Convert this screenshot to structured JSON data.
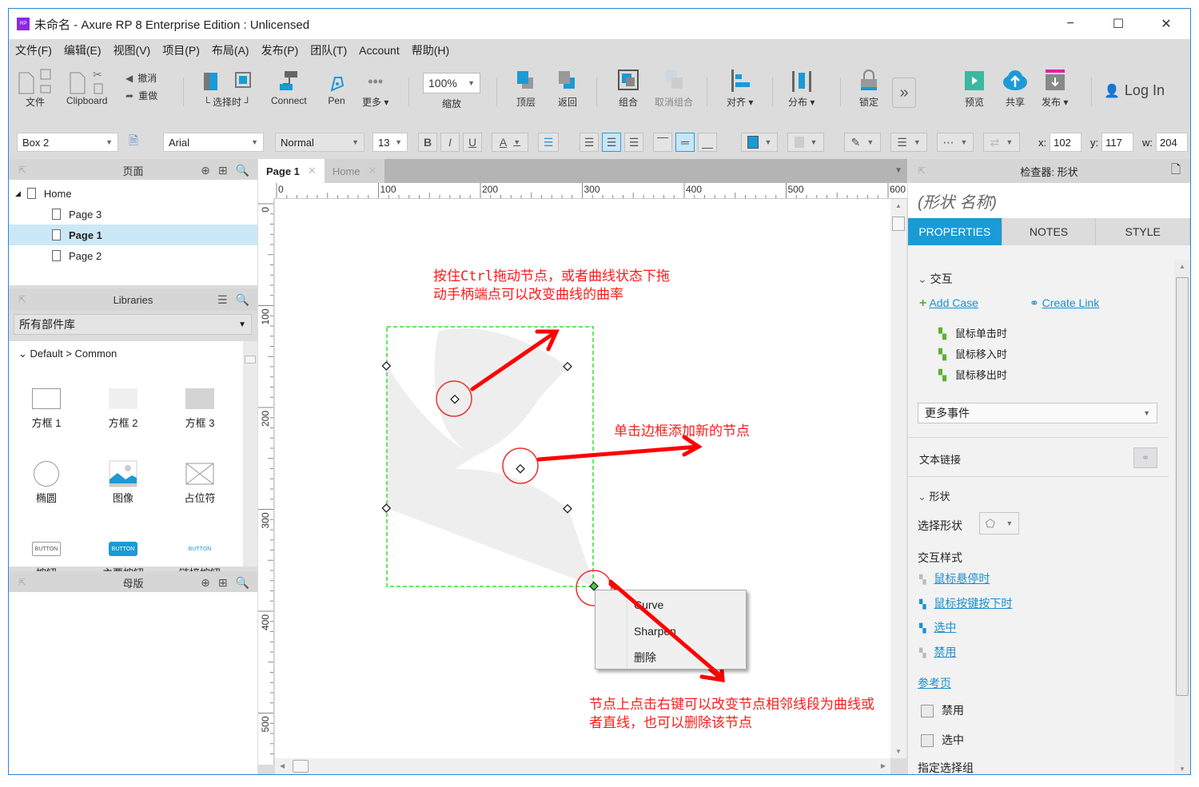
{
  "window": {
    "title": "未命名 - Axure RP 8 Enterprise Edition : Unlicensed",
    "buttons": {
      "minimize": "−",
      "maximize": "☐",
      "close": "✕"
    }
  },
  "menu": [
    "文件(F)",
    "编辑(E)",
    "视图(V)",
    "项目(P)",
    "布局(A)",
    "发布(P)",
    "团队(T)",
    "Account",
    "帮助(H)"
  ],
  "toolbar": {
    "file": "文件",
    "clipboard": "Clipboard",
    "undo": "撤消",
    "redo": "重做",
    "select_mode": "└ 选择时 ┘",
    "connect": "Connect",
    "pen": "Pen",
    "more": "更多 ▾",
    "zoom_value": "100%",
    "zoom_label": "缩放",
    "top_layer": "顶层",
    "back": "返回",
    "group": "组合",
    "ungroup": "取消组合",
    "align": "对齐 ▾",
    "distribute": "分布 ▾",
    "lock": "锁定",
    "overflow": "»",
    "preview": "预览",
    "share": "共享",
    "publish": "发布 ▾",
    "login": "Log In"
  },
  "format": {
    "widget_name": "Box 2",
    "font": "Arial",
    "style": "Normal",
    "size": "13",
    "bold": "B",
    "italic": "I",
    "underline": "U",
    "font_color": "A",
    "x_label": "x:",
    "x": "102",
    "y_label": "y:",
    "y": "117",
    "w_label": "w:",
    "w": "204"
  },
  "pages_panel": {
    "title": "页面",
    "items": [
      {
        "label": "Home",
        "level": 0
      },
      {
        "label": "Page 3",
        "level": 1
      },
      {
        "label": "Page 1",
        "level": 1,
        "selected": true
      },
      {
        "label": "Page 2",
        "level": 1
      }
    ]
  },
  "libraries_panel": {
    "title": "Libraries",
    "dropdown": "所有部件库",
    "group": "Default > Common",
    "items": [
      "方框 1",
      "方框 2",
      "方框 3",
      "椭圆",
      "图像",
      "占位符",
      "按钮",
      "主要按钮",
      "链接按钮"
    ],
    "button_text": "BUTTON"
  },
  "masters_panel": {
    "title": "母版"
  },
  "canvas": {
    "tabs": [
      {
        "label": "Page 1",
        "active": true
      },
      {
        "label": "Home",
        "active": false
      }
    ],
    "ruler_h": [
      "0",
      "100",
      "200",
      "300",
      "400",
      "500",
      "600"
    ],
    "ruler_v": [
      "0",
      "100",
      "200",
      "300",
      "400",
      "500"
    ],
    "notes": {
      "note1": "按住Ctrl拖动节点，或者曲线状态下拖动手柄端点可以改变曲线的曲率",
      "note2": "单击边框添加新的节点",
      "note3": "节点上点击右键可以改变节点相邻线段为曲线或者直线，也可以删除该节点"
    },
    "context_menu": [
      "Curve",
      "Sharpen",
      "删除"
    ],
    "annotation_color": "#ff1a1a"
  },
  "inspector": {
    "title": "检查器: 形状",
    "shape_name_placeholder": "(形状 名称)",
    "tabs": [
      "PROPERTIES",
      "NOTES",
      "STYLE"
    ],
    "interaction_header": "交互",
    "add_case": "Add Case",
    "create_link": "Create Link",
    "events": [
      "鼠标单击时",
      "鼠标移入时",
      "鼠标移出时"
    ],
    "more_events": "更多事件",
    "text_link": "文本链接",
    "shape_header": "形状",
    "select_shape": "选择形状",
    "interaction_styles": "交互样式",
    "styles": [
      "鼠标悬停时",
      "鼠标按键按下时",
      "选中",
      "禁用"
    ],
    "reference_page": "参考页",
    "disabled": "禁用",
    "selected": "选中",
    "selection_group": "指定选择组",
    "accent": "#1b9ad6"
  }
}
